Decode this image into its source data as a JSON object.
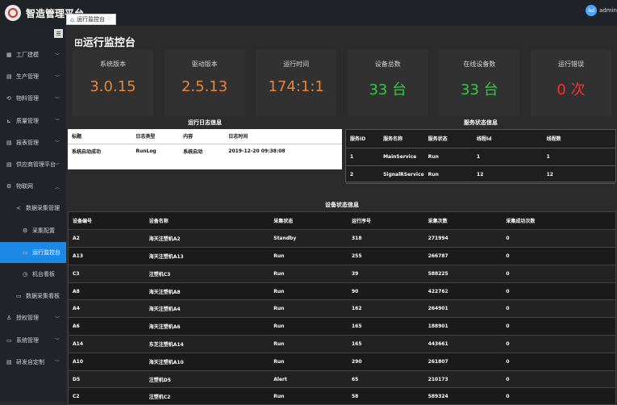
{
  "app": {
    "title": "智造管理平台",
    "user": "admin",
    "avatar_text": "Ad"
  },
  "tab": {
    "label": "运行监控台"
  },
  "page": {
    "title": "运行监控台"
  },
  "stats": [
    {
      "label": "系统版本",
      "value": "3.0.15",
      "color": "#e8843b"
    },
    {
      "label": "驱动版本",
      "value": "2.5.13",
      "color": "#e8843b"
    },
    {
      "label": "运行时间",
      "value": "174:1:1",
      "color": "#e8843b"
    },
    {
      "label": "设备总数",
      "value": "33 台",
      "color": "#2ecc40"
    },
    {
      "label": "在线设备数",
      "value": "33 台",
      "color": "#2ecc40"
    },
    {
      "label": "运行错误",
      "value": "0 次",
      "color": "#ff2d2d"
    }
  ],
  "sidebar": [
    {
      "icon": "▦",
      "label": "工厂建模",
      "chev": "﹀",
      "level": 0
    },
    {
      "icon": "▤",
      "label": "生产管理",
      "chev": "﹀",
      "level": 0
    },
    {
      "icon": "⟲",
      "label": "物料管理",
      "chev": "﹀",
      "level": 0
    },
    {
      "icon": "⊾",
      "label": "质量管理",
      "chev": "﹀",
      "level": 0
    },
    {
      "icon": "▤",
      "label": "报表管理",
      "chev": "﹀",
      "level": 0
    },
    {
      "icon": "▤",
      "label": "供应商管理平台",
      "chev": "﹀",
      "level": 0
    },
    {
      "icon": "⚙",
      "label": "物联网",
      "chev": "︿",
      "level": 0
    },
    {
      "icon": "≺",
      "label": "数据采集管理",
      "chev": "︿",
      "level": 1
    },
    {
      "icon": "⚙",
      "label": "采集配置",
      "chev": "",
      "level": 2
    },
    {
      "icon": "▭",
      "label": "运行监控台",
      "chev": "",
      "level": 2,
      "active": true
    },
    {
      "icon": "◷",
      "label": "机台看板",
      "chev": "",
      "level": 2
    },
    {
      "icon": "▭",
      "label": "数据采集看板",
      "chev": "",
      "level": 1
    },
    {
      "icon": "♙",
      "label": "授权管理",
      "chev": "﹀",
      "level": 0
    },
    {
      "icon": "▭",
      "label": "系统管理",
      "chev": "﹀",
      "level": 0
    },
    {
      "icon": "▤",
      "label": "研发自定制",
      "chev": "﹀",
      "level": 0
    }
  ],
  "log_panel": {
    "title": "运行日志信息",
    "columns": [
      "标题",
      "日志类型",
      "内容",
      "日志时间"
    ],
    "rows": [
      [
        "系统启动成功",
        "RunLog",
        "系统启动",
        "2019-12-20 09:38:08"
      ]
    ]
  },
  "service_panel": {
    "title": "服务状态信息",
    "columns": [
      "服务ID",
      "服务名称",
      "服务状态",
      "线程Id",
      "线程数"
    ],
    "rows": [
      [
        "1",
        "MainService",
        "Run",
        "1",
        "1"
      ],
      [
        "2",
        "SignalRService",
        "Run",
        "12",
        "12"
      ]
    ]
  },
  "device_panel": {
    "title": "设备状态信息",
    "columns": [
      "设备编号",
      "设备名称",
      "采集状态",
      "运行序号",
      "采集次数",
      "采集成功次数"
    ],
    "rows": [
      [
        "A2",
        "海天注塑机A2",
        "Standby",
        "318",
        "271994",
        "0"
      ],
      [
        "A13",
        "海天注塑机A13",
        "Run",
        "255",
        "266787",
        "0"
      ],
      [
        "C3",
        "注塑机C3",
        "Run",
        "39",
        "588225",
        "0"
      ],
      [
        "A8",
        "海天注塑机A8",
        "Run",
        "90",
        "422762",
        "0"
      ],
      [
        "A4",
        "海天注塑机A4",
        "Run",
        "162",
        "264901",
        "0"
      ],
      [
        "A6",
        "海天注塑机A6",
        "Run",
        "165",
        "188901",
        "0"
      ],
      [
        "A14",
        "东芝注塑机A14",
        "Run",
        "165",
        "443661",
        "0"
      ],
      [
        "A10",
        "海天注塑机A10",
        "Run",
        "290",
        "261807",
        "0"
      ],
      [
        "D5",
        "注塑机D5",
        "Alert",
        "65",
        "210173",
        "0"
      ],
      [
        "C2",
        "注塑机C2",
        "Run",
        "58",
        "589324",
        "0"
      ]
    ]
  }
}
